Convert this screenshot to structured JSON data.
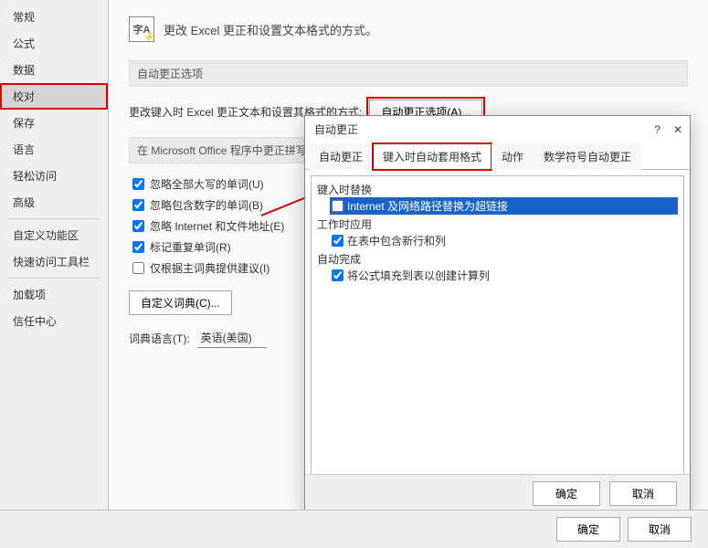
{
  "sidebar": {
    "items": [
      {
        "label": "常规"
      },
      {
        "label": "公式"
      },
      {
        "label": "数据"
      },
      {
        "label": "校对"
      },
      {
        "label": "保存"
      },
      {
        "label": "语言"
      },
      {
        "label": "轻松访问"
      },
      {
        "label": "高级"
      },
      {
        "label": "自定义功能区"
      },
      {
        "label": "快速访问工具栏"
      },
      {
        "label": "加载项"
      },
      {
        "label": "信任中心"
      }
    ]
  },
  "main": {
    "header": "更改 Excel 更正和设置文本格式的方式。",
    "section_autocorrect": "自动更正选项",
    "autocorrect_line": "更改键入时 Excel 更正文本和设置其格式的方式:",
    "autocorrect_btn": "自动更正选项(A)...",
    "section_spelling": "在 Microsoft Office 程序中更正拼写时",
    "checks": [
      {
        "label": "忽略全部大写的单词(U)",
        "checked": true
      },
      {
        "label": "忽略包含数字的单词(B)",
        "checked": true
      },
      {
        "label": "忽略 Internet 和文件地址(E)",
        "checked": true
      },
      {
        "label": "标记重复单词(R)",
        "checked": true
      },
      {
        "label": "仅根据主词典提供建议(I)",
        "checked": false
      }
    ],
    "custom_dict_btn": "自定义词典(C)...",
    "dict_lang_label": "词典语言(T):",
    "dict_lang_value": "英语(美国)"
  },
  "dialog": {
    "title": "自动更正",
    "help": "?",
    "close": "✕",
    "tabs": [
      {
        "label": "自动更正"
      },
      {
        "label": "键入时自动套用格式"
      },
      {
        "label": "动作"
      },
      {
        "label": "数学符号自动更正"
      }
    ],
    "group1": "键入时替换",
    "item1": "Internet 及网络路径替换为超链接",
    "group2": "工作时应用",
    "item2": "在表中包含新行和列",
    "group3": "自动完成",
    "item3": "将公式填充到表以创建计算列",
    "ok": "确定",
    "cancel": "取消"
  },
  "footer": {
    "ok": "确定",
    "cancel": "取消"
  }
}
